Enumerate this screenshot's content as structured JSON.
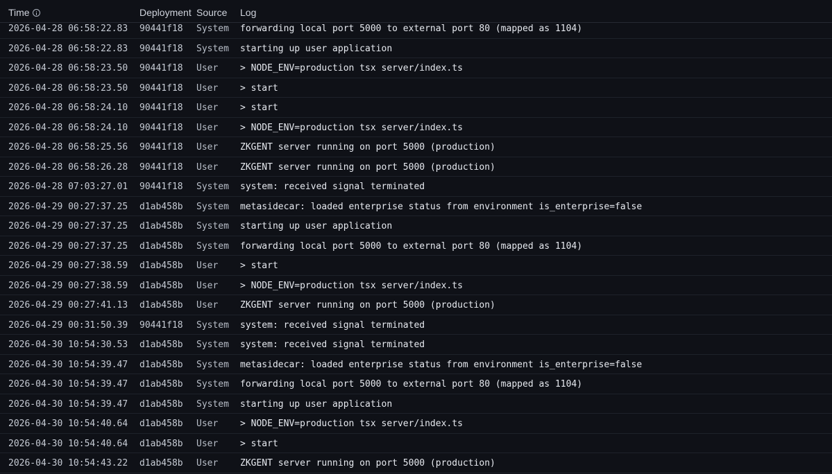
{
  "header": {
    "time_label": "Time",
    "deployment_label": "Deployment",
    "source_label": "Source",
    "log_label": "Log"
  },
  "rows": [
    {
      "time": "2026-04-28 06:58:22.83",
      "deployment": "90441f18",
      "source": "System",
      "log": "forwarding local port 5000 to external port 80 (mapped as 1104)"
    },
    {
      "time": "2026-04-28 06:58:22.83",
      "deployment": "90441f18",
      "source": "System",
      "log": "starting up user application"
    },
    {
      "time": "2026-04-28 06:58:23.50",
      "deployment": "90441f18",
      "source": "User",
      "log": "> NODE_ENV=production tsx server/index.ts"
    },
    {
      "time": "2026-04-28 06:58:23.50",
      "deployment": "90441f18",
      "source": "User",
      "log": "> start"
    },
    {
      "time": "2026-04-28 06:58:24.10",
      "deployment": "90441f18",
      "source": "User",
      "log": "> start"
    },
    {
      "time": "2026-04-28 06:58:24.10",
      "deployment": "90441f18",
      "source": "User",
      "log": "> NODE_ENV=production tsx server/index.ts"
    },
    {
      "time": "2026-04-28 06:58:25.56",
      "deployment": "90441f18",
      "source": "User",
      "log": "ZKGENT server running on port 5000 (production)"
    },
    {
      "time": "2026-04-28 06:58:26.28",
      "deployment": "90441f18",
      "source": "User",
      "log": "ZKGENT server running on port 5000 (production)"
    },
    {
      "time": "2026-04-28 07:03:27.01",
      "deployment": "90441f18",
      "source": "System",
      "log": "system: received signal terminated"
    },
    {
      "time": "2026-04-29 00:27:37.25",
      "deployment": "d1ab458b",
      "source": "System",
      "log": "metasidecar: loaded enterprise status from environment is_enterprise=false"
    },
    {
      "time": "2026-04-29 00:27:37.25",
      "deployment": "d1ab458b",
      "source": "System",
      "log": "starting up user application"
    },
    {
      "time": "2026-04-29 00:27:37.25",
      "deployment": "d1ab458b",
      "source": "System",
      "log": "forwarding local port 5000 to external port 80 (mapped as 1104)"
    },
    {
      "time": "2026-04-29 00:27:38.59",
      "deployment": "d1ab458b",
      "source": "User",
      "log": "> start"
    },
    {
      "time": "2026-04-29 00:27:38.59",
      "deployment": "d1ab458b",
      "source": "User",
      "log": "> NODE_ENV=production tsx server/index.ts"
    },
    {
      "time": "2026-04-29 00:27:41.13",
      "deployment": "d1ab458b",
      "source": "User",
      "log": "ZKGENT server running on port 5000 (production)"
    },
    {
      "time": "2026-04-29 00:31:50.39",
      "deployment": "90441f18",
      "source": "System",
      "log": "system: received signal terminated"
    },
    {
      "time": "2026-04-30 10:54:30.53",
      "deployment": "d1ab458b",
      "source": "System",
      "log": "system: received signal terminated"
    },
    {
      "time": "2026-04-30 10:54:39.47",
      "deployment": "d1ab458b",
      "source": "System",
      "log": "metasidecar: loaded enterprise status from environment is_enterprise=false"
    },
    {
      "time": "2026-04-30 10:54:39.47",
      "deployment": "d1ab458b",
      "source": "System",
      "log": "forwarding local port 5000 to external port 80 (mapped as 1104)"
    },
    {
      "time": "2026-04-30 10:54:39.47",
      "deployment": "d1ab458b",
      "source": "System",
      "log": "starting up user application"
    },
    {
      "time": "2026-04-30 10:54:40.64",
      "deployment": "d1ab458b",
      "source": "User",
      "log": "> NODE_ENV=production tsx server/index.ts"
    },
    {
      "time": "2026-04-30 10:54:40.64",
      "deployment": "d1ab458b",
      "source": "User",
      "log": "> start"
    },
    {
      "time": "2026-04-30 10:54:43.22",
      "deployment": "d1ab458b",
      "source": "User",
      "log": "ZKGENT server running on port 5000 (production)"
    }
  ]
}
